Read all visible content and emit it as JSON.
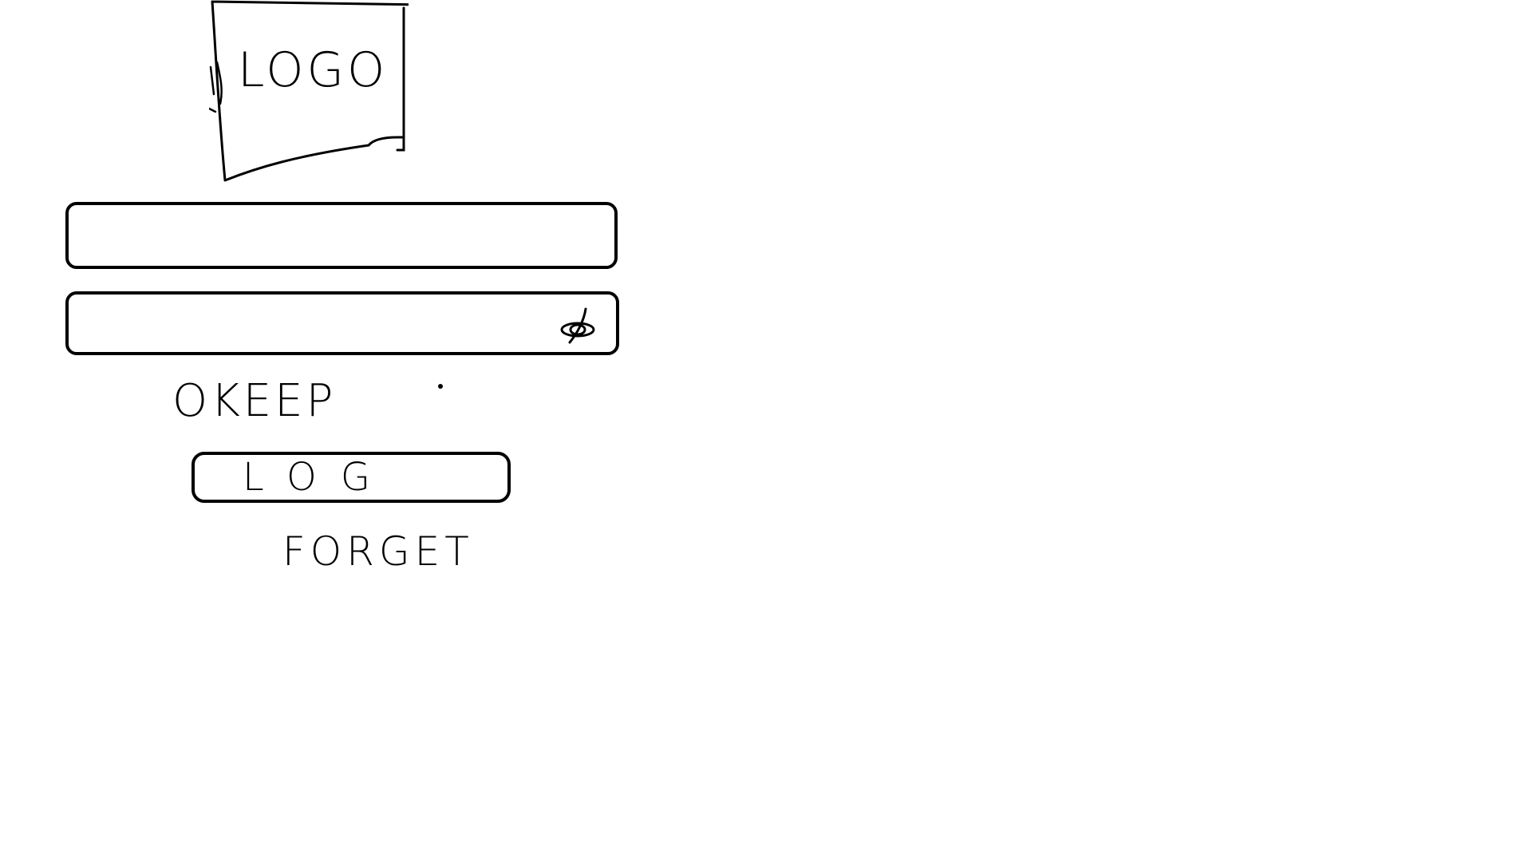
{
  "logo": {
    "text": "LOGO"
  },
  "login_form": {
    "username": {
      "value": "",
      "placeholder": ""
    },
    "password": {
      "value": "",
      "placeholder": "",
      "visibility_icon": "eye-slash-icon"
    },
    "keep_label": "OKEEP",
    "login_button_label": "LOG",
    "forget_link_label": "FORGET"
  },
  "colors": {
    "stroke": "#000000",
    "background": "#ffffff"
  }
}
